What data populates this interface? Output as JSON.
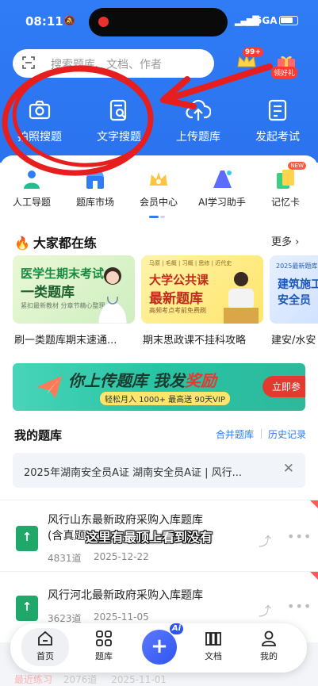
{
  "status_bar": {
    "time": "08:11",
    "network": "5GA"
  },
  "search": {
    "placeholder": "搜索题库、文档、作者"
  },
  "header_badges": {
    "vip_count": "99+",
    "gift_label": "领好礼"
  },
  "quick_actions": [
    {
      "label": "拍照搜题",
      "icon": "camera-icon"
    },
    {
      "label": "文字搜题",
      "icon": "text-search-icon"
    },
    {
      "label": "上传题库",
      "icon": "upload-cloud-icon"
    },
    {
      "label": "发起考试",
      "icon": "exam-icon"
    }
  ],
  "categories": [
    {
      "label": "人工导题",
      "icon": "person-import-icon"
    },
    {
      "label": "题库市场",
      "icon": "market-icon"
    },
    {
      "label": "会员中心",
      "icon": "crown-icon"
    },
    {
      "label": "AI学习助手",
      "icon": "ai-assistant-icon"
    },
    {
      "label": "记忆卡",
      "icon": "memory-card-icon",
      "badge": "NEW"
    }
  ],
  "popular": {
    "title": "大家都在练",
    "more": "更多",
    "banners": [
      {
        "line1": "医学生期末考试",
        "line2": "一类题库",
        "tag": "满分必刷",
        "small": "紧扣最新教材 分章节精心整理",
        "caption": "刷一类题库期末速通..."
      },
      {
        "tags": "马原 | 毛概 | 习概 | 思修 | 近代史",
        "line1": "大学公共课",
        "line2": "最新题库",
        "small": "高频考点考前免费刷",
        "caption": "期末思政课不挂科攻略"
      },
      {
        "tags": "2025最新题库",
        "line1": "建筑施工",
        "line2": "安全员",
        "small": "三类人员题库",
        "caption": "建安/水安"
      }
    ]
  },
  "promo": {
    "headline_a": "你上传题库 我发",
    "headline_b": "奖励",
    "sub": "轻松月入 1000+ 最高送 90天VIP",
    "cta": "立即参"
  },
  "my_bank": {
    "title": "我的题库",
    "merge": "合并题库",
    "history": "历史记录",
    "recent_text": "2025年湖南安全员A证 湖南安全员A证 | 风行...",
    "items": [
      {
        "name_line1": "风行山东最新政府采购入库题库",
        "name_line2": "(含真题",
        "count": "4831道",
        "date": "2025-12-22"
      },
      {
        "name_line1": "风行河北最新政府采购入库题库",
        "count": "3623道",
        "date": "2025-11-05"
      }
    ],
    "faded": {
      "tag": "最近练习",
      "count": "2076道",
      "date": "2025-11-01"
    }
  },
  "video_subtitle": "这里有最顶上看到没有",
  "bottom_nav": [
    {
      "label": "首页",
      "icon": "home-icon"
    },
    {
      "label": "题库",
      "icon": "grid-icon"
    },
    {
      "label": "文档",
      "icon": "document-icon"
    },
    {
      "label": "我的",
      "icon": "profile-icon"
    }
  ],
  "fab": {
    "badge": "Ai"
  },
  "colors": {
    "primary": "#2f7cf6",
    "annotation": "#e61e1e"
  }
}
